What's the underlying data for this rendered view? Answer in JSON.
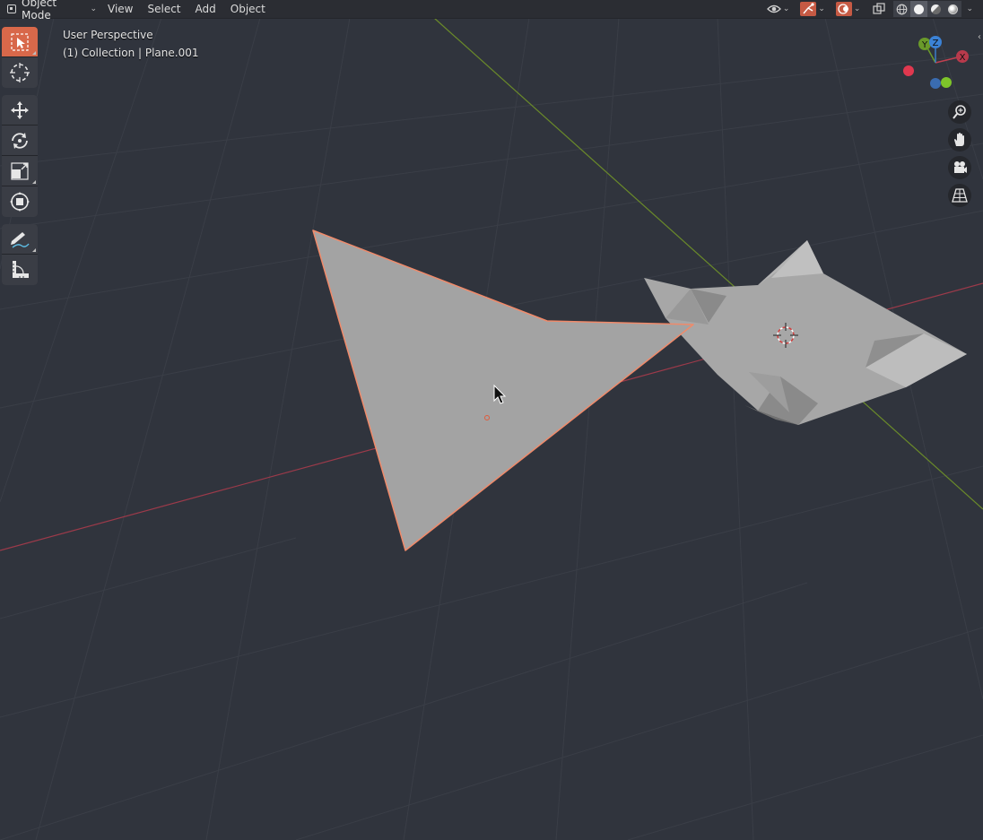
{
  "header": {
    "mode_label": "Object Mode",
    "menus": [
      "View",
      "Select",
      "Add",
      "Object"
    ]
  },
  "overlay": {
    "view_name": "User Perspective",
    "collection_info": "(1) Collection | Plane.001"
  },
  "toolbar": {
    "tools": [
      {
        "name": "select-box",
        "active": true
      },
      {
        "name": "cursor",
        "active": false
      },
      {
        "name": "move",
        "active": false
      },
      {
        "name": "rotate",
        "active": false
      },
      {
        "name": "scale",
        "active": false
      },
      {
        "name": "transform",
        "active": false
      },
      {
        "name": "annotate",
        "active": false
      },
      {
        "name": "measure",
        "active": false
      }
    ]
  },
  "gizmo": {
    "x_label": "X",
    "y_label": "Y",
    "z_label": "Z"
  },
  "colors": {
    "background": "#30343d",
    "grid": "#3b3f48",
    "x_axis": "#9c3a4a",
    "y_axis": "#6a8a2a",
    "selection": "#f08060",
    "mesh": "#a2a2a2",
    "active_tool": "#d8684a"
  },
  "icons": {
    "header_right": [
      "visibility-icon",
      "gizmo-icon",
      "overlay-icon",
      "xray-icon",
      "wireframe-shading-icon",
      "solid-shading-icon",
      "material-shading-icon",
      "rendered-shading-icon"
    ],
    "nav": [
      "zoom-icon",
      "pan-hand-icon",
      "camera-icon",
      "perspective-grid-icon"
    ]
  }
}
